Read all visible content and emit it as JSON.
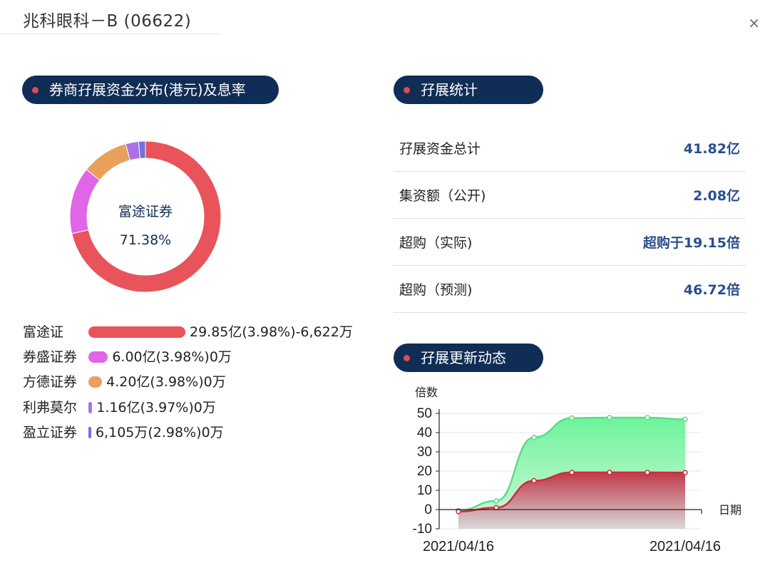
{
  "header": {
    "title": "兆科眼科－B (06622)",
    "close_label": "×"
  },
  "left_panel": {
    "title": "券商孖展资金分布(港元)及息率",
    "donut": {
      "selected_name": "富途证券",
      "selected_percent": "71.38%"
    },
    "brokers": [
      {
        "name": "富途证",
        "value": "29.85亿(3.98%)-6,622万",
        "share": 0.7138,
        "color": "#e8545a"
      },
      {
        "name": "券盛证券",
        "value": "6.00亿(3.98%)0万",
        "share": 0.1435,
        "color": "#df66e6"
      },
      {
        "name": "方德证券",
        "value": "4.20亿(3.98%)0万",
        "share": 0.1004,
        "color": "#e9a05a"
      },
      {
        "name": "利弗莫尔",
        "value": "1.16亿(3.97%)0万",
        "share": 0.0277,
        "color": "#a872e6"
      },
      {
        "name": "盈立证券",
        "value": "6,105万(2.98%)0万",
        "share": 0.0146,
        "color": "#6f73e0"
      }
    ]
  },
  "stats_panel": {
    "title": "孖展统计",
    "rows": [
      {
        "label": "孖展资金总计",
        "value": "41.82亿"
      },
      {
        "label": "集资额（公开)",
        "value": "2.08亿"
      },
      {
        "label": "超购（实际)",
        "value": "超购于19.15倍"
      },
      {
        "label": "超购（预测)",
        "value": "46.72倍"
      }
    ]
  },
  "trend_panel": {
    "title": "孖展更新动态"
  },
  "chart_data": {
    "type": "area",
    "ylabel": "倍数",
    "xlabel": "日期",
    "ylim": [
      -10,
      50
    ],
    "yticks": [
      50,
      40,
      30,
      20,
      10,
      0,
      -10
    ],
    "x_tick_labels": [
      "2021/04/16",
      "2021/04/16"
    ],
    "grid": true,
    "series": [
      {
        "values": [
          -0.5,
          4.5,
          37.5,
          47.6,
          47.8,
          47.8,
          46.9
        ],
        "color": "#5fd98a",
        "fill": "#6cf59a"
      },
      {
        "values": [
          -1,
          1,
          15,
          19.3,
          19.3,
          19.3,
          19.2
        ],
        "color": "#d12a3e",
        "fill": "#c0394a"
      }
    ]
  }
}
